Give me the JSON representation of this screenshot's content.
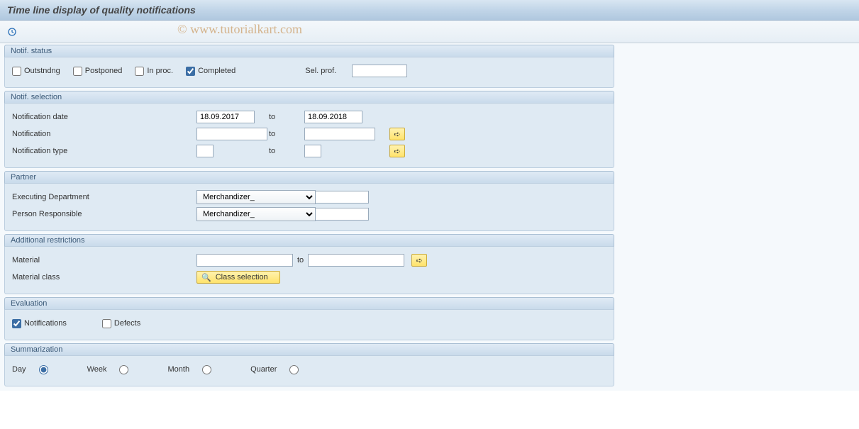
{
  "title": "Time line display of quality notifications",
  "watermark": "© www.tutorialkart.com",
  "groups": {
    "notif_status": {
      "title": "Notif. status",
      "outstanding_label": "Outstndng",
      "postponed_label": "Postponed",
      "inproc_label": "In proc.",
      "completed_label": "Completed",
      "completed_checked": true,
      "sel_prof_label": "Sel. prof.",
      "sel_prof_value": ""
    },
    "notif_selection": {
      "title": "Notif. selection",
      "date_label": "Notification date",
      "date_from": "18.09.2017",
      "date_to": "18.09.2018",
      "notification_label": "Notification",
      "notification_from": "",
      "notification_to": "",
      "type_label": "Notification type",
      "type_from": "",
      "type_to": "",
      "to_label": "to"
    },
    "partner": {
      "title": "Partner",
      "exec_dept_label": "Executing Department",
      "exec_dept_value": "Merchandizer_",
      "exec_dept_extra": "",
      "person_resp_label": "Person Responsible",
      "person_resp_value": "Merchandizer_",
      "person_resp_extra": ""
    },
    "additional": {
      "title": "Additional restrictions",
      "material_label": "Material",
      "material_from": "",
      "material_to": "",
      "to_label": "to",
      "material_class_label": "Material class",
      "class_selection_label": "Class selection"
    },
    "evaluation": {
      "title": "Evaluation",
      "notifications_label": "Notifications",
      "notifications_checked": true,
      "defects_label": "Defects"
    },
    "summarization": {
      "title": "Summarization",
      "day_label": "Day",
      "week_label": "Week",
      "month_label": "Month",
      "quarter_label": "Quarter",
      "selected": "day"
    }
  }
}
